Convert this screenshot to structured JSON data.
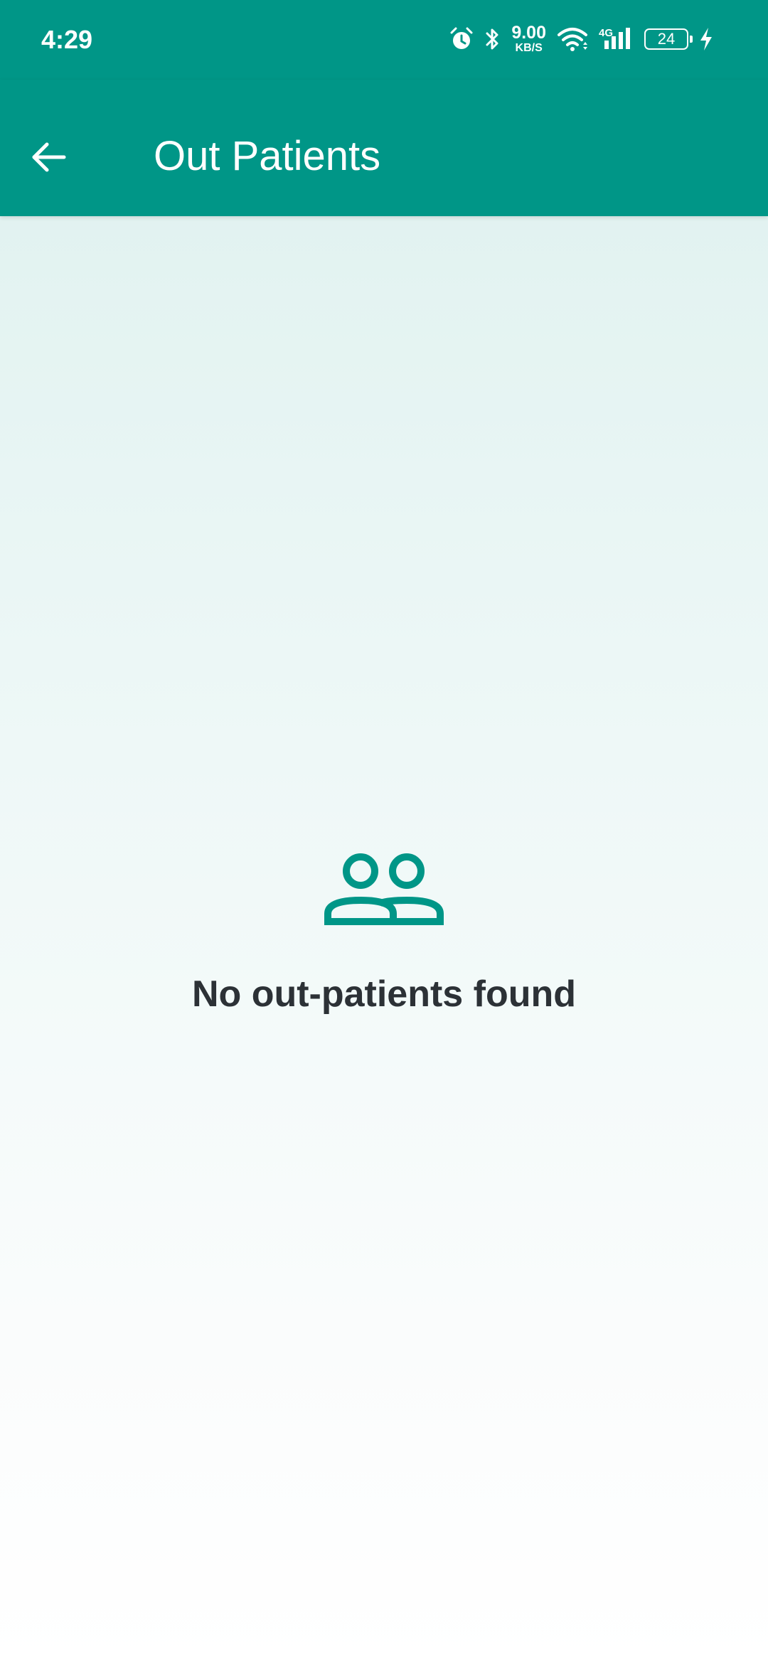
{
  "status_bar": {
    "time": "4:29",
    "network_speed_value": "9.00",
    "network_speed_unit": "KB/S",
    "network_type": "4G",
    "battery_level": "24",
    "icons": [
      "alarm-icon",
      "bluetooth-icon",
      "wifi-icon",
      "signal-icon",
      "battery-icon",
      "charging-icon"
    ]
  },
  "app_bar": {
    "title": "Out Patients",
    "back_icon": "arrow-back-icon"
  },
  "empty_state": {
    "icon": "people-icon",
    "message": "No out-patients found"
  },
  "colors": {
    "primary": "#009687",
    "on_primary": "#ffffff",
    "text_primary": "#2c3136",
    "background_top": "#ddf0ee",
    "background_bottom": "#ffffff"
  }
}
